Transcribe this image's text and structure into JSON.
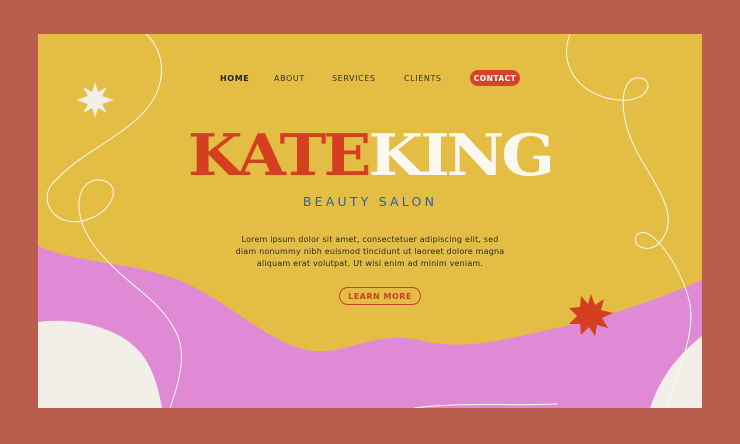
{
  "colors": {
    "frame": "#b95e4e",
    "background": "#e3bd44",
    "accent_red": "#d44427",
    "pink": "#e08ad6",
    "cream": "#f1efe7",
    "blue": "#2d5ea5"
  },
  "nav": {
    "items": [
      "HOME",
      "ABOUT",
      "SERVICES",
      "CLIENTS"
    ],
    "active": "HOME",
    "cta": "CONTACT"
  },
  "hero": {
    "title_part1": "KATE",
    "title_part2": "KING",
    "subtitle": "BEAUTY SALON",
    "body_lines": [
      "Lorem ipsum dolor sit amet, consectetuer adipiscing elit, sed",
      "diam nonummy nibh euismod tincidunt ut laoreet dolore magna",
      "aliquam erat volutpat. Ut wisi enim ad minim veniam."
    ],
    "button": "LEARN MORE"
  },
  "decorations": {
    "icons": [
      "sparkle-star-icon",
      "red-starburst-icon"
    ]
  }
}
